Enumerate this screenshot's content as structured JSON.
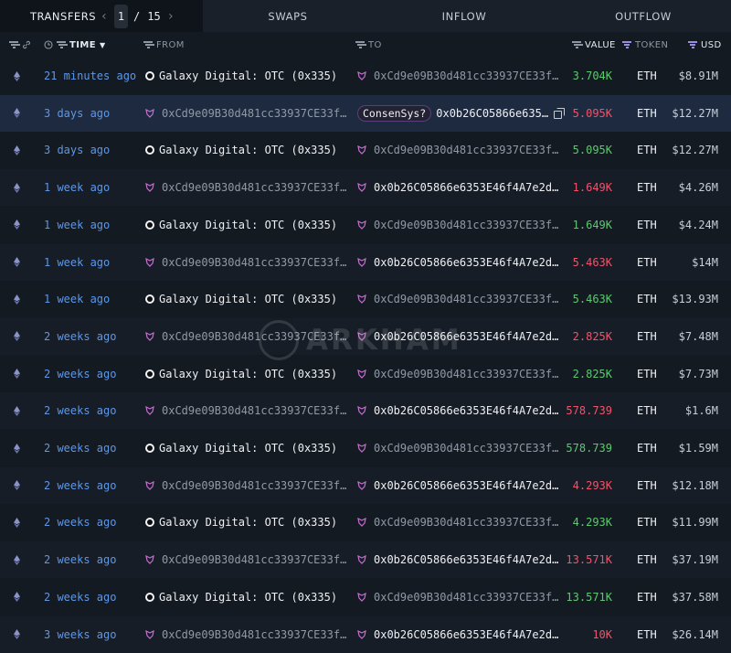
{
  "tabs": {
    "transfers": "TRANSFERS",
    "page_current": "1",
    "page_sep": "/",
    "page_total": "15",
    "prev_icon": "chevron-left-icon",
    "next_icon": "chevron-right-icon",
    "swaps": "SWAPS",
    "inflow": "INFLOW",
    "outflow": "OUTFLOW"
  },
  "columns": {
    "time": "TIME",
    "from": "FROM",
    "to": "TO",
    "value": "VALUE",
    "token": "TOKEN",
    "usd": "USD"
  },
  "colors": {
    "time_link": "#5d97e8",
    "value_in": "#5cc96f",
    "value_out": "#f0536a",
    "entity_pink": "#c86fd2",
    "selected_row": "#1d2a40"
  },
  "watermark": "ARKHAM",
  "rows": [
    {
      "time": "21 minutes ago",
      "from": "Galaxy Digital: OTC (0x335)",
      "to": "0xCd9e09B30d481cc33937CE33f…",
      "value": "3.704K",
      "token": "ETH",
      "usd": "$8.91M"
    },
    {
      "time": "3 days ago",
      "from": "0xCd9e09B30d481cc33937CE33f…",
      "to_label": "ConsenSys?",
      "to": "0x0b26C05866e635…",
      "value": "5.095K",
      "token": "ETH",
      "usd": "$12.27M"
    },
    {
      "time": "3 days ago",
      "from": "Galaxy Digital: OTC (0x335)",
      "to": "0xCd9e09B30d481cc33937CE33f…",
      "value": "5.095K",
      "token": "ETH",
      "usd": "$12.27M"
    },
    {
      "time": "1 week ago",
      "from": "0xCd9e09B30d481cc33937CE33f…",
      "to": "0x0b26C05866e6353E46f4A7e2d…",
      "value": "1.649K",
      "token": "ETH",
      "usd": "$4.26M"
    },
    {
      "time": "1 week ago",
      "from": "Galaxy Digital: OTC (0x335)",
      "to": "0xCd9e09B30d481cc33937CE33f…",
      "value": "1.649K",
      "token": "ETH",
      "usd": "$4.24M"
    },
    {
      "time": "1 week ago",
      "from": "0xCd9e09B30d481cc33937CE33f…",
      "to": "0x0b26C05866e6353E46f4A7e2d…",
      "value": "5.463K",
      "token": "ETH",
      "usd": "$14M"
    },
    {
      "time": "1 week ago",
      "from": "Galaxy Digital: OTC (0x335)",
      "to": "0xCd9e09B30d481cc33937CE33f…",
      "value": "5.463K",
      "token": "ETH",
      "usd": "$13.93M"
    },
    {
      "time": "2 weeks ago",
      "from": "0xCd9e09B30d481cc33937CE33f…",
      "to": "0x0b26C05866e6353E46f4A7e2d…",
      "value": "2.825K",
      "token": "ETH",
      "usd": "$7.48M"
    },
    {
      "time": "2 weeks ago",
      "from": "Galaxy Digital: OTC (0x335)",
      "to": "0xCd9e09B30d481cc33937CE33f…",
      "value": "2.825K",
      "token": "ETH",
      "usd": "$7.73M"
    },
    {
      "time": "2 weeks ago",
      "from": "0xCd9e09B30d481cc33937CE33f…",
      "to": "0x0b26C05866e6353E46f4A7e2d…",
      "value": "578.739",
      "token": "ETH",
      "usd": "$1.6M"
    },
    {
      "time": "2 weeks ago",
      "from": "Galaxy Digital: OTC (0x335)",
      "to": "0xCd9e09B30d481cc33937CE33f…",
      "value": "578.739",
      "token": "ETH",
      "usd": "$1.59M"
    },
    {
      "time": "2 weeks ago",
      "from": "0xCd9e09B30d481cc33937CE33f…",
      "to": "0x0b26C05866e6353E46f4A7e2d…",
      "value": "4.293K",
      "token": "ETH",
      "usd": "$12.18M"
    },
    {
      "time": "2 weeks ago",
      "from": "Galaxy Digital: OTC (0x335)",
      "to": "0xCd9e09B30d481cc33937CE33f…",
      "value": "4.293K",
      "token": "ETH",
      "usd": "$11.99M"
    },
    {
      "time": "2 weeks ago",
      "from": "0xCd9e09B30d481cc33937CE33f…",
      "to": "0x0b26C05866e6353E46f4A7e2d…",
      "value": "13.571K",
      "token": "ETH",
      "usd": "$37.19M"
    },
    {
      "time": "2 weeks ago",
      "from": "Galaxy Digital: OTC (0x335)",
      "to": "0xCd9e09B30d481cc33937CE33f…",
      "value": "13.571K",
      "token": "ETH",
      "usd": "$37.58M"
    },
    {
      "time": "3 weeks ago",
      "from": "0xCd9e09B30d481cc33937CE33f…",
      "to": "0x0b26C05866e6353E46f4A7e2d…",
      "value": "10K",
      "token": "ETH",
      "usd": "$26.14M"
    }
  ]
}
